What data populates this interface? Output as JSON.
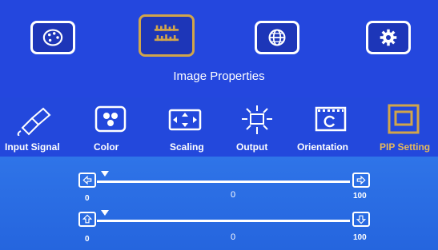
{
  "menu": {
    "title": "Image Properties",
    "top_icons": [
      "palette-icon",
      "image-properties-icon",
      "globe-icon",
      "gear-icon"
    ],
    "sub_items": [
      {
        "label": "Input Signal",
        "icon": "hdmi-cable-icon"
      },
      {
        "label": "Color",
        "icon": "color-icon"
      },
      {
        "label": "Scaling",
        "icon": "scaling-icon"
      },
      {
        "label": "Output",
        "icon": "output-icon"
      },
      {
        "label": "Orientation",
        "icon": "orientation-icon"
      },
      {
        "label": "PIP Setting",
        "icon": "pip-icon"
      }
    ]
  },
  "sliders": [
    {
      "name": "horizontal-position",
      "min_label": "0",
      "value_label": "0",
      "max_label": "100",
      "value": 0
    },
    {
      "name": "vertical-position",
      "min_label": "0",
      "value_label": "0",
      "max_label": "100",
      "value": 0
    }
  ],
  "colors": {
    "background": "#1f3fd2",
    "selected_border": "#d1a54a",
    "panel": "#2a6ce3"
  }
}
